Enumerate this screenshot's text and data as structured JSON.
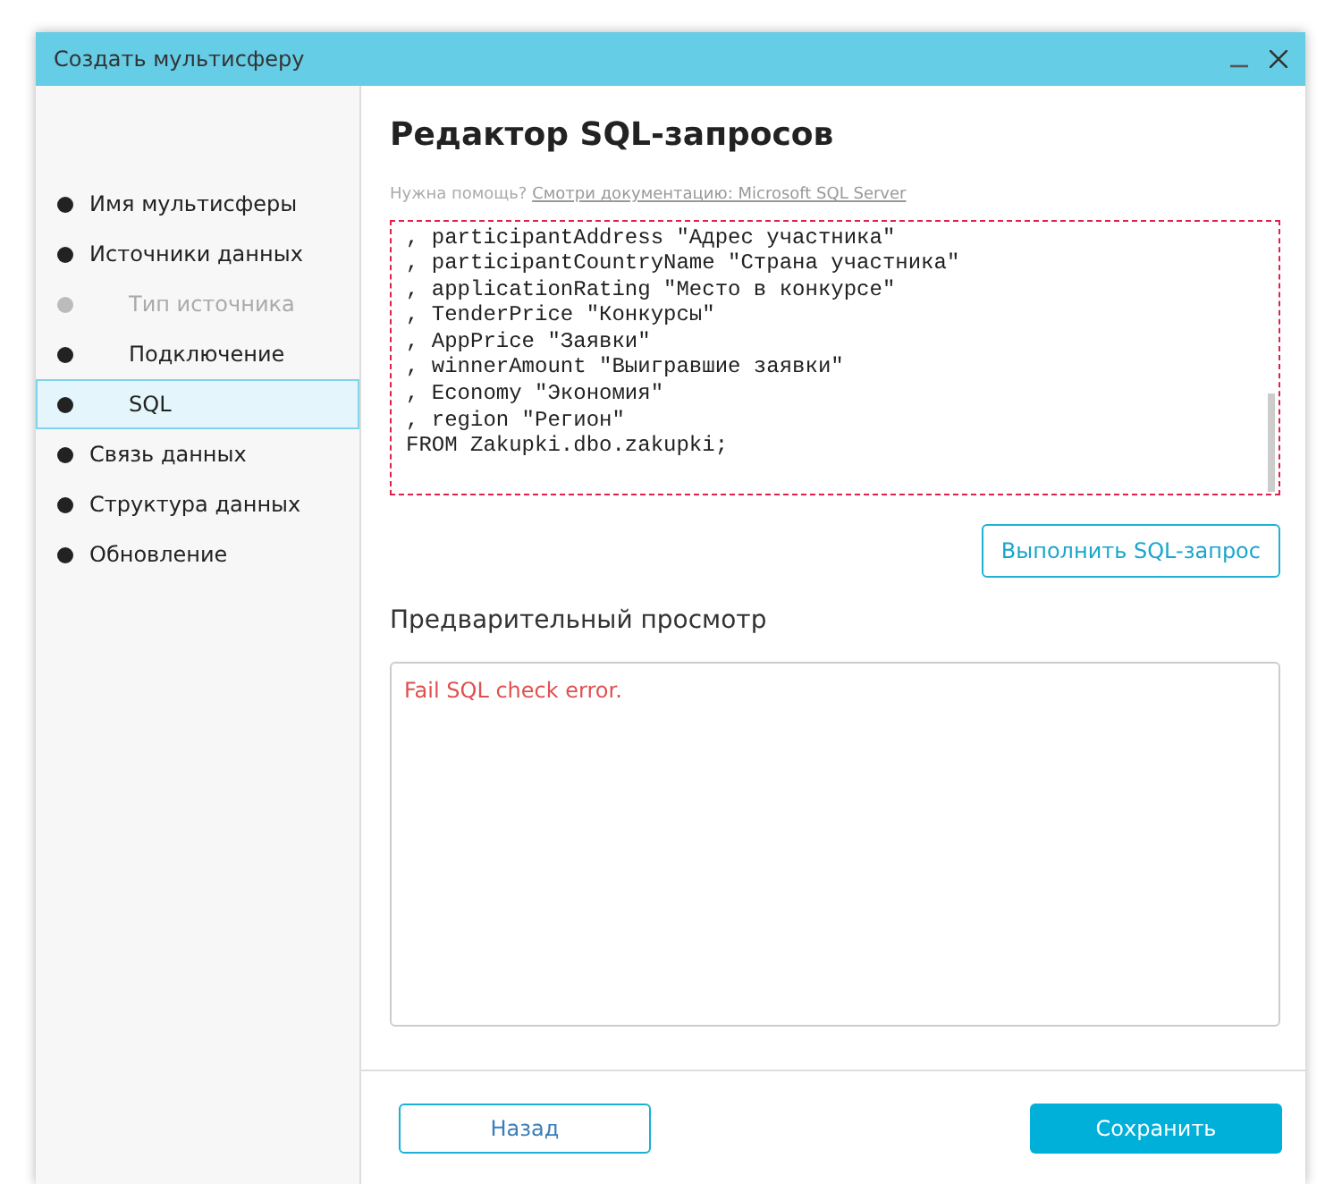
{
  "window": {
    "title": "Создать мультисферу"
  },
  "sidebar": {
    "items": [
      {
        "label": "Имя мультисферы",
        "kind": "step",
        "disabled": false,
        "selected": false
      },
      {
        "label": "Источники данных",
        "kind": "step",
        "disabled": false,
        "selected": false
      },
      {
        "label": "Тип источника",
        "kind": "substep",
        "disabled": true,
        "selected": false
      },
      {
        "label": "Подключение",
        "kind": "substep",
        "disabled": false,
        "selected": false
      },
      {
        "label": "SQL",
        "kind": "substep",
        "disabled": false,
        "selected": true
      },
      {
        "label": "Связь данных",
        "kind": "step",
        "disabled": false,
        "selected": false
      },
      {
        "label": "Структура данных",
        "kind": "step",
        "disabled": false,
        "selected": false
      },
      {
        "label": "Обновление",
        "kind": "step",
        "disabled": false,
        "selected": false
      }
    ]
  },
  "editor": {
    "title": "Редактор SQL-запросов",
    "help_text": "Нужна помощь?",
    "help_link": "Смотри документацию: Microsoft SQL Server",
    "sql_lines": [
      ", participantAddress \"Адрес участника\"",
      ", participantCountryName \"Страна участника\"",
      ", applicationRating \"Место в конкурсе\"",
      ", TenderPrice \"Конкурсы\"",
      ", AppPrice \"Заявки\"",
      ", winnerAmount \"Выигравшие заявки\"",
      ", Economy \"Экономия\"",
      ", region \"Регион\"",
      "FROM Zakupki.dbo.zakupki;"
    ],
    "run_button": "Выполнить SQL-запрос"
  },
  "preview": {
    "title": "Предварительный просмотр",
    "message": "Fail SQL check error."
  },
  "footer": {
    "back_button": "Назад",
    "save_button": "Сохранить"
  }
}
